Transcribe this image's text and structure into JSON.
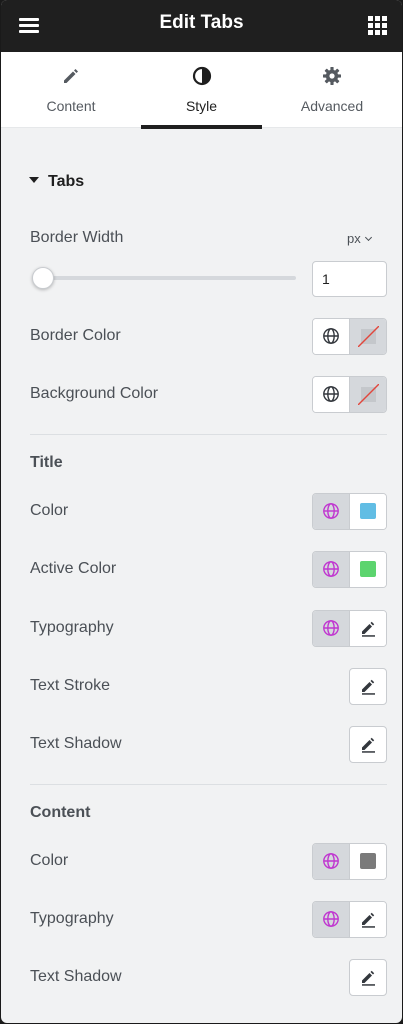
{
  "header": {
    "title": "Edit Tabs",
    "menu_icon": "hamburger-icon",
    "apps_icon": "grid-icon"
  },
  "tabs": [
    {
      "label": "Content",
      "icon": "pencil-icon",
      "active": false
    },
    {
      "label": "Style",
      "icon": "contrast-icon",
      "active": true
    },
    {
      "label": "Advanced",
      "icon": "gear-icon",
      "active": false
    }
  ],
  "section": {
    "title": "Tabs",
    "expanded": true
  },
  "border_width": {
    "label": "Border Width",
    "unit": "px",
    "value": "1"
  },
  "border_color": {
    "label": "Border Color"
  },
  "background_color": {
    "label": "Background Color"
  },
  "title_group": {
    "heading": "Title",
    "color": {
      "label": "Color",
      "swatch": "#61bde4"
    },
    "active_color": {
      "label": "Active Color",
      "swatch": "#5cd46e"
    },
    "typography": {
      "label": "Typography"
    },
    "text_stroke": {
      "label": "Text Stroke"
    },
    "text_shadow": {
      "label": "Text Shadow"
    }
  },
  "content_group": {
    "heading": "Content",
    "color": {
      "label": "Color",
      "swatch": "#7a7a7a"
    },
    "typography": {
      "label": "Typography"
    },
    "text_shadow": {
      "label": "Text Shadow"
    }
  },
  "colors": {
    "global_active": "#c036d0",
    "accent_dark": "#1f1f1f",
    "none_slash": "#e2463c"
  }
}
